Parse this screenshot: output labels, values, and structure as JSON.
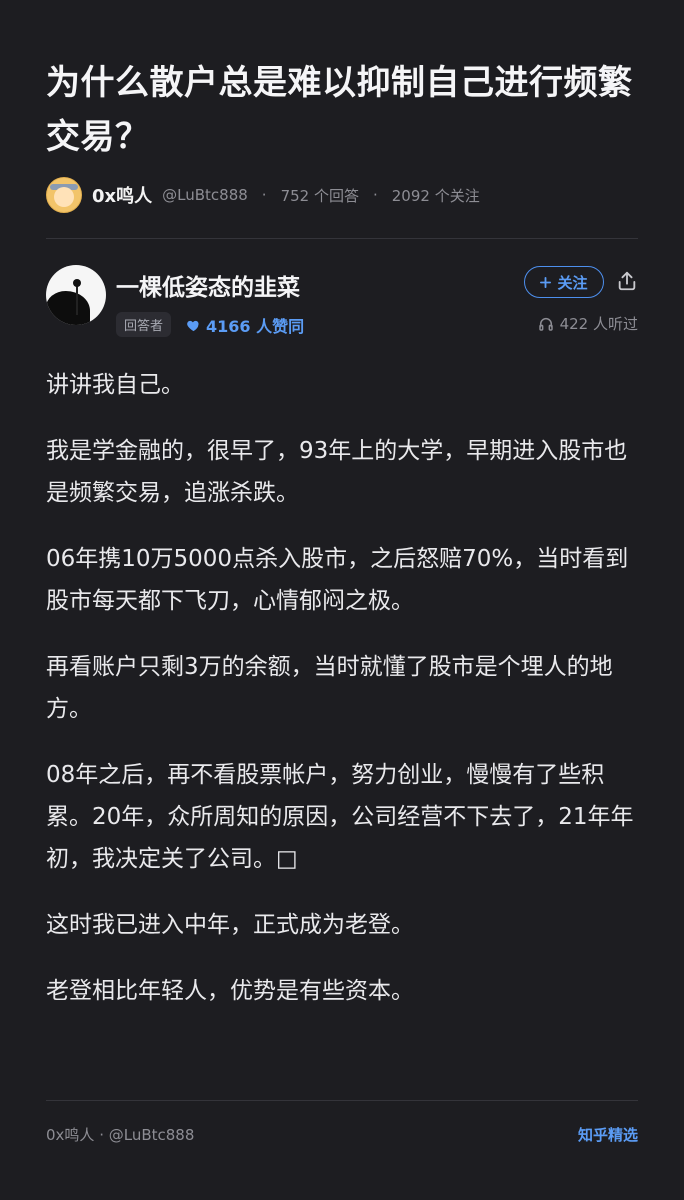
{
  "question": {
    "title": "为什么散户总是难以抑制自己进行频繁交易？",
    "author_name": "0x鸣人",
    "author_handle": "@LuBtc888",
    "answers": "752 个回答",
    "separator": "·",
    "followers": "2092 个关注"
  },
  "answer": {
    "author_name": "一棵低姿态的韭菜",
    "badge": "回答者",
    "likes": "4166 人赞同",
    "follow_label": "关注",
    "listeners": "422 人听过",
    "paragraphs": [
      "讲讲我自己。",
      "我是学金融的，很早了，93年上的大学，早期进入股市也是频繁交易，追涨杀跌。",
      "06年携10万5000点杀入股市，之后怒赔70%，当时看到股市每天都下飞刀，心情郁闷之极。",
      "再看账户只剩3万的余额，当时就懂了股市是个埋人的地方。",
      "08年之后，再不看股票帐户，努力创业，慢慢有了些积累。20年，众所周知的原因，公司经营不下去了，21年年初，我决定关了公司。□",
      "这时我已进入中年，正式成为老登。",
      "老登相比年轻人，优势是有些资本。"
    ]
  },
  "footer": {
    "source": "0x鸣人 · @LuBtc888",
    "brand": "知乎精选"
  },
  "colors": {
    "background": "#1d1d21",
    "accent": "#5b9cf5",
    "muted": "#8d8d94"
  },
  "icons": [
    "heart-icon",
    "plus-icon",
    "share-icon",
    "headphones-icon"
  ]
}
